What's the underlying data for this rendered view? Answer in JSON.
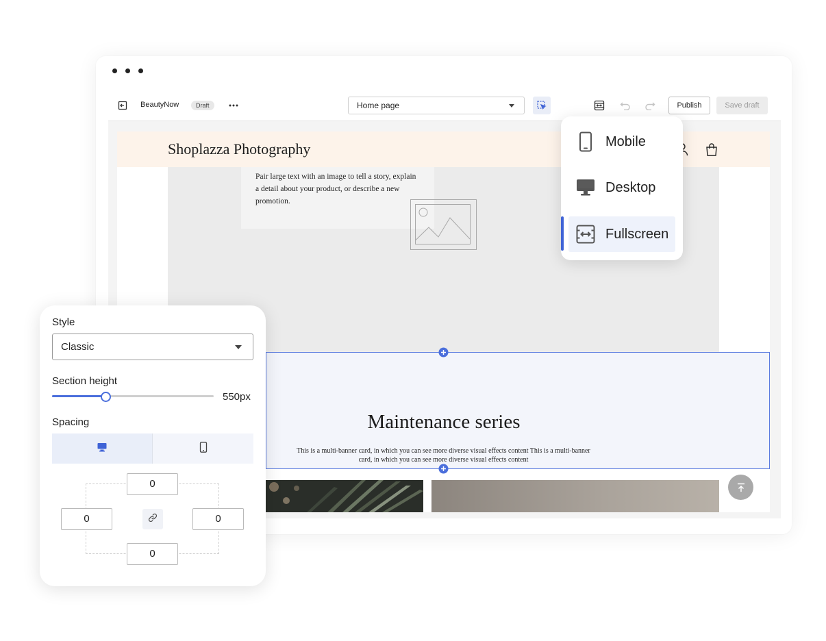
{
  "editor": {
    "store_name": "BeautyNow",
    "status_badge": "Draft",
    "page_selector": {
      "selected": "Home page"
    },
    "publish_label": "Publish",
    "save_draft_label": "Save draft"
  },
  "device_menu": {
    "items": [
      {
        "label": "Mobile",
        "icon": "mobile-icon",
        "active": false
      },
      {
        "label": "Desktop",
        "icon": "desktop-icon",
        "active": false
      },
      {
        "label": "Fullscreen",
        "icon": "fullscreen-icon",
        "active": true
      }
    ]
  },
  "preview": {
    "site_title": "Shoplazza Photography",
    "hero_text": "Pair large text with an image to tell a story, explain a detail about your product, or describe a new promotion.",
    "section_title": "Maintenance series",
    "section_desc": "This is a multi-banner card, in which you can see more diverse visual effects content This is a multi-banner card, in which you can see more diverse visual effects content"
  },
  "settings": {
    "style_label": "Style",
    "style_value": "Classic",
    "section_height_label": "Section height",
    "section_height_value": "550px",
    "section_height_fraction": 0.33,
    "spacing_label": "Spacing",
    "spacing": {
      "top": "0",
      "left": "0",
      "right": "0",
      "bottom": "0"
    }
  },
  "colors": {
    "accent": "#4b6fdc",
    "header_bg": "#fdf3ea",
    "selection_bg": "#f3f5fb"
  }
}
